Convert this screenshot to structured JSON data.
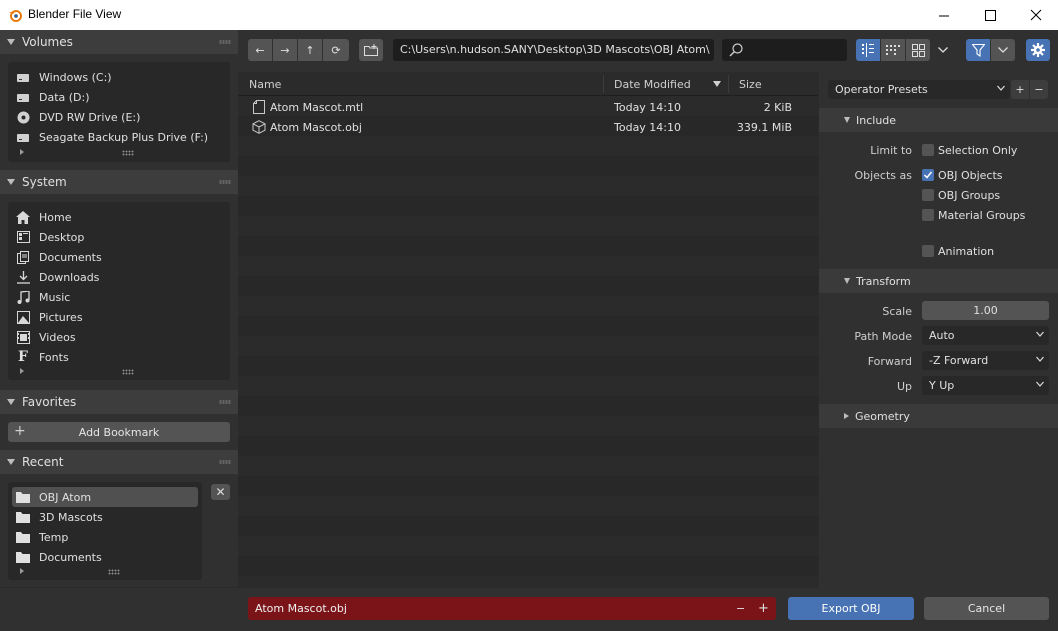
{
  "window": {
    "title": "Blender File View"
  },
  "sidebar": {
    "volumes": {
      "title": "Volumes",
      "items": [
        {
          "label": "Windows (C:)",
          "icon": "disk-icon"
        },
        {
          "label": "Data (D:)",
          "icon": "disk-icon"
        },
        {
          "label": "DVD RW Drive (E:)",
          "icon": "disc-icon"
        },
        {
          "label": "Seagate Backup Plus Drive (F:)",
          "icon": "disk-icon"
        }
      ]
    },
    "system": {
      "title": "System",
      "items": [
        {
          "label": "Home",
          "icon": "home-icon"
        },
        {
          "label": "Desktop",
          "icon": "desktop-icon"
        },
        {
          "label": "Documents",
          "icon": "documents-icon"
        },
        {
          "label": "Downloads",
          "icon": "download-icon"
        },
        {
          "label": "Music",
          "icon": "music-icon"
        },
        {
          "label": "Pictures",
          "icon": "pictures-icon"
        },
        {
          "label": "Videos",
          "icon": "videos-icon"
        },
        {
          "label": "Fonts",
          "icon": "fonts-icon"
        }
      ]
    },
    "favorites": {
      "title": "Favorites",
      "add_bookmark_label": "Add Bookmark"
    },
    "recent": {
      "title": "Recent",
      "items": [
        {
          "label": "OBJ Atom",
          "icon": "folder-icon",
          "selected": true
        },
        {
          "label": "3D Mascots",
          "icon": "folder-icon"
        },
        {
          "label": "Temp",
          "icon": "folder-icon"
        },
        {
          "label": "Documents",
          "icon": "folder-icon"
        }
      ]
    }
  },
  "toolbar": {
    "path": "C:\\Users\\n.hudson.SANY\\Desktop\\3D Mascots\\OBJ Atom\\",
    "search_placeholder": ""
  },
  "file_list": {
    "columns": {
      "name": "Name",
      "date": "Date Modified",
      "size": "Size",
      "sort": "date-descending"
    },
    "files": [
      {
        "name": "Atom Mascot.mtl",
        "date": "Today 14:10",
        "size": "2 KiB",
        "icon": "file-icon"
      },
      {
        "name": "Atom Mascot.obj",
        "date": "Today 14:10",
        "size": "339.1 MiB",
        "icon": "mesh-cube-icon"
      }
    ]
  },
  "properties": {
    "operator_presets": "Operator Presets",
    "include": {
      "title": "Include",
      "limit_to_label": "Limit to",
      "selection_only": {
        "label": "Selection Only",
        "checked": false
      },
      "objects_as_label": "Objects as",
      "obj_objects": {
        "label": "OBJ Objects",
        "checked": true
      },
      "obj_groups": {
        "label": "OBJ Groups",
        "checked": false
      },
      "material_groups": {
        "label": "Material Groups",
        "checked": false
      },
      "animation": {
        "label": "Animation",
        "checked": false
      }
    },
    "transform": {
      "title": "Transform",
      "scale_label": "Scale",
      "scale_value": "1.00",
      "path_mode_label": "Path Mode",
      "path_mode_value": "Auto",
      "forward_label": "Forward",
      "forward_value": "-Z Forward",
      "up_label": "Up",
      "up_value": "Y Up"
    },
    "geometry": {
      "title": "Geometry"
    }
  },
  "footer": {
    "filename": "Atom Mascot.obj",
    "export_label": "Export OBJ",
    "cancel_label": "Cancel"
  },
  "colors": {
    "accent": "#4772b3",
    "filename_bg": "#7a1418"
  }
}
